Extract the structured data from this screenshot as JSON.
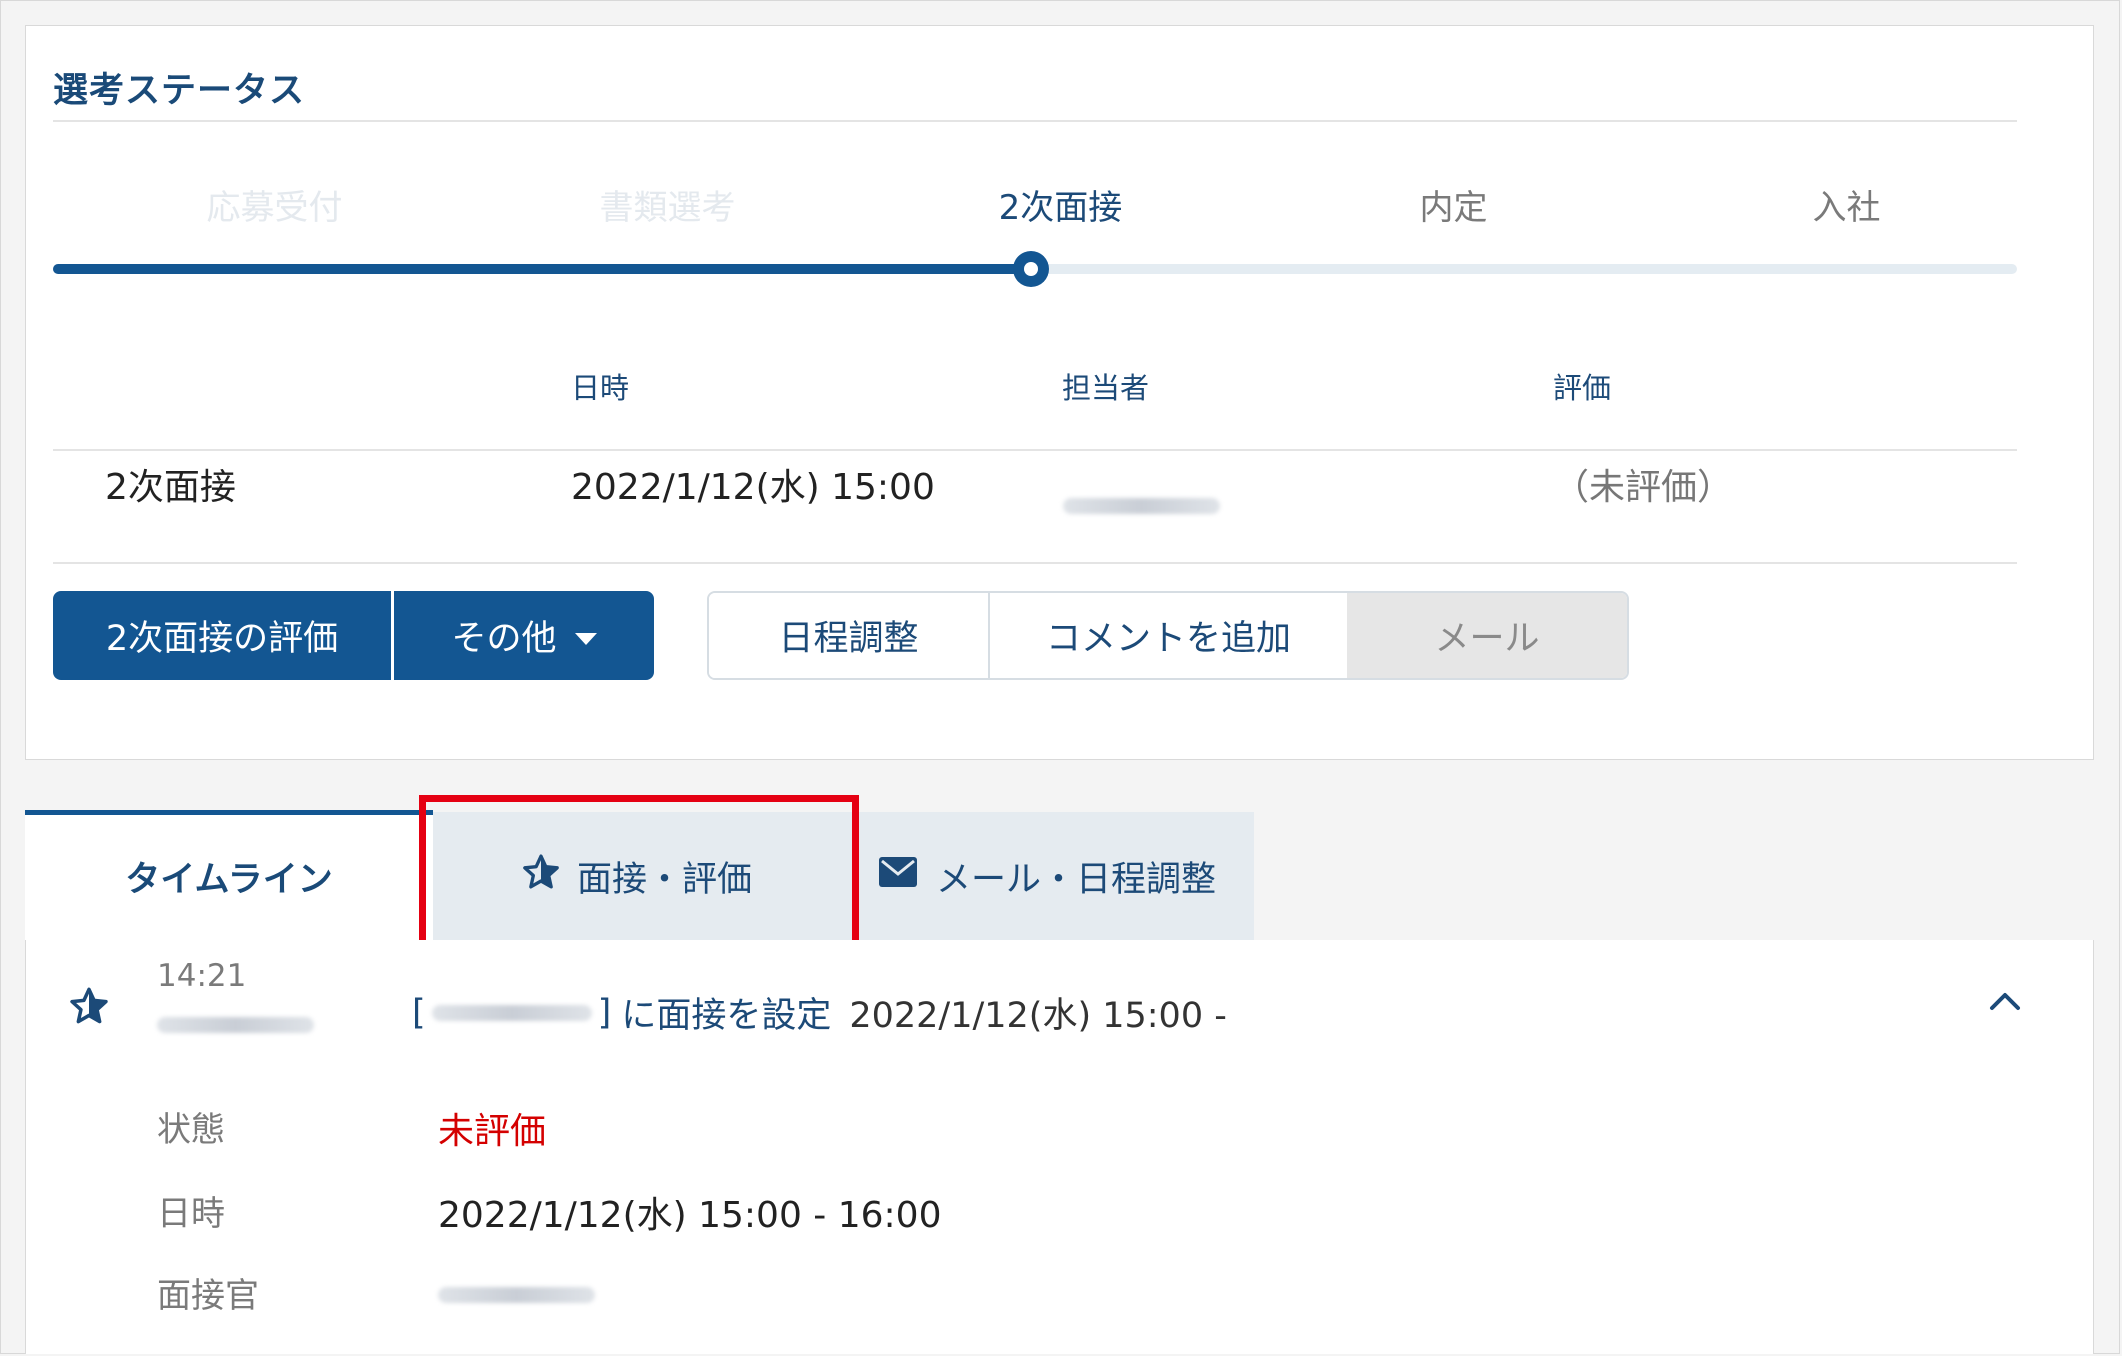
{
  "status": {
    "title": "選考ステータス",
    "steps": [
      {
        "label": "応募受付",
        "state": "done"
      },
      {
        "label": "書類選考",
        "state": "done"
      },
      {
        "label": "2次面接",
        "state": "current"
      },
      {
        "label": "内定",
        "state": "upcoming"
      },
      {
        "label": "入社",
        "state": "upcoming"
      }
    ],
    "table": {
      "headers": {
        "datetime": "日時",
        "person": "担当者",
        "rating": "評価"
      },
      "row": {
        "stage": "2次面接",
        "datetime": "2022/1/12(水) 15:00",
        "rating": "（未評価）"
      }
    },
    "buttons": {
      "evaluate": "2次面接の評価",
      "other": "その他",
      "schedule": "日程調整",
      "add_comment": "コメントを追加",
      "mail": "メール"
    }
  },
  "tabs": {
    "timeline": "タイムライン",
    "interview": "面接・評価",
    "mail_schedule": "メール・日程調整"
  },
  "timeline": {
    "entry": {
      "time": "14:21",
      "bracket_open": "[",
      "bracket_close": "]",
      "action": "に面接を設定",
      "datetime": "2022/1/12(水) 15:00 -",
      "details": {
        "status_label": "状態",
        "status_value": "未評価",
        "datetime_label": "日時",
        "datetime_value": "2022/1/12(水) 15:00 - 16:00",
        "interviewer_label": "面接官"
      }
    }
  },
  "colors": {
    "primary": "#135692",
    "heading": "#1a4a78",
    "highlight": "#e50012",
    "alert": "#d40000",
    "tab_bg": "#e5ebf0"
  }
}
